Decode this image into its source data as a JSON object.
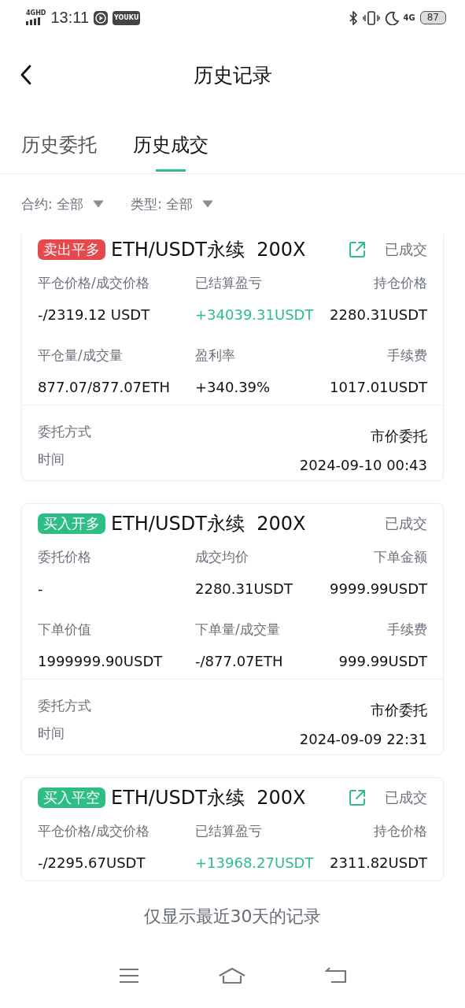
{
  "status_bar": {
    "signal_label": "4GHD",
    "time": "13:11",
    "app_badge": "YOUKU",
    "network": "4G",
    "battery": "87"
  },
  "header": {
    "title": "历史记录"
  },
  "tabs": [
    {
      "label": "历史委托",
      "selected": false
    },
    {
      "label": "历史成交",
      "selected": true
    }
  ],
  "filters": [
    {
      "label": "合约:",
      "value": "全部"
    },
    {
      "label": "类型:",
      "value": "全部"
    }
  ],
  "cards": [
    {
      "tag": {
        "text": "卖出平多",
        "kind": "sell"
      },
      "title": "ETH/USDT永续  200X",
      "share": true,
      "status": "已成交",
      "cells": [
        {
          "label": "平仓价格/成交价格",
          "value": "-/2319.12 USDT",
          "positive": false
        },
        {
          "label": "已结算盈亏",
          "value": "+34039.31USDT",
          "positive": true
        },
        {
          "label": "持仓价格",
          "value": "2280.31USDT",
          "positive": false
        },
        {
          "label": "平仓量/成交量",
          "value": "877.07/877.07ETH",
          "positive": false
        },
        {
          "label": "盈利率",
          "value": "+340.39%",
          "positive": false
        },
        {
          "label": "手续费",
          "value": "1017.01USDT",
          "positive": false
        }
      ],
      "details": [
        {
          "label": "委托方式",
          "value": "市价委托"
        },
        {
          "label": "时间",
          "value": "2024-09-10 00:43"
        }
      ]
    },
    {
      "tag": {
        "text": "买入开多",
        "kind": "buy"
      },
      "title": "ETH/USDT永续  200X",
      "share": false,
      "status": "已成交",
      "cells": [
        {
          "label": "委托价格",
          "value": "-",
          "positive": false
        },
        {
          "label": "成交均价",
          "value": "2280.31USDT",
          "positive": false
        },
        {
          "label": "下单金额",
          "value": "9999.99USDT",
          "positive": false
        },
        {
          "label": "下单价值",
          "value": "1999999.90USDT",
          "positive": false
        },
        {
          "label": "下单量/成交量",
          "value": "-/877.07ETH",
          "positive": false
        },
        {
          "label": "手续费",
          "value": "999.99USDT",
          "positive": false
        }
      ],
      "details": [
        {
          "label": "委托方式",
          "value": "市价委托"
        },
        {
          "label": "时间",
          "value": "2024-09-09 22:31"
        }
      ]
    },
    {
      "tag": {
        "text": "买入平空",
        "kind": "buy"
      },
      "title": "ETH/USDT永续  200X",
      "share": true,
      "status": "已成交",
      "cells": [
        {
          "label": "平仓价格/成交价格",
          "value": "-/2295.67USDT",
          "positive": false
        },
        {
          "label": "已结算盈亏",
          "value": "+13968.27USDT",
          "positive": true
        },
        {
          "label": "持仓价格",
          "value": "2311.82USDT",
          "positive": false
        }
      ]
    }
  ],
  "footer_note": "仅显示最近30天的记录"
}
